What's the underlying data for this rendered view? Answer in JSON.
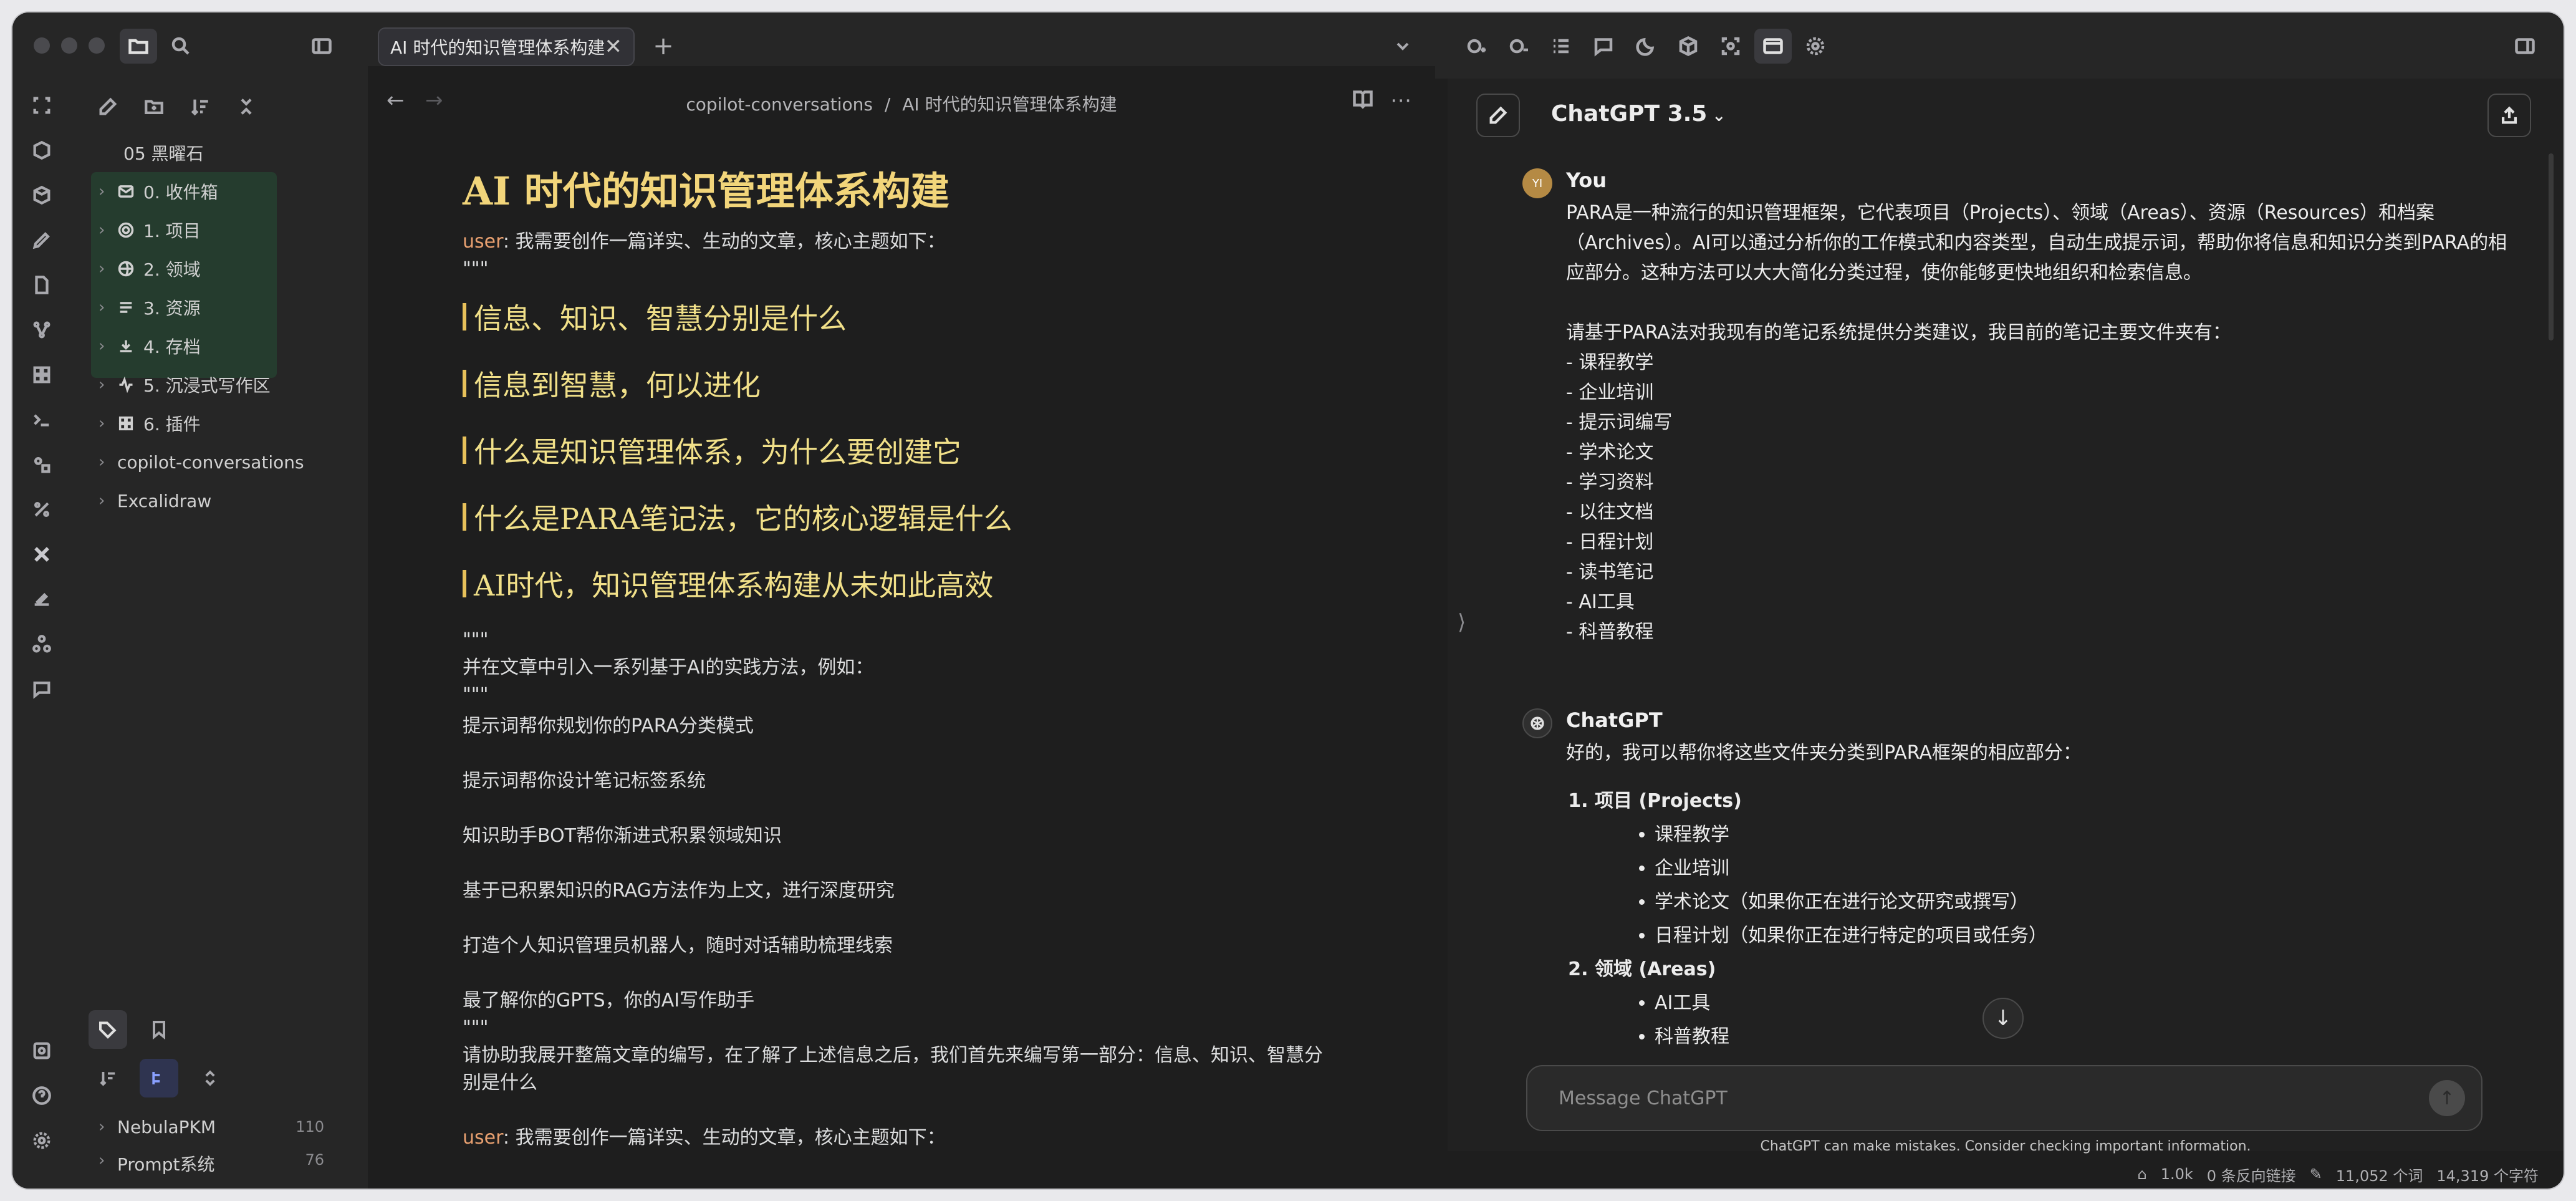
{
  "tab": {
    "title": "AI 时代的知识管理体系构建",
    "close": "✕",
    "add": "+"
  },
  "explorer": {
    "vault_title": "05 黑曜石",
    "items": [
      {
        "label": "0. 收件箱",
        "icon": "inbox-icon"
      },
      {
        "label": "1. 项目",
        "icon": "target-icon"
      },
      {
        "label": "2. 领域",
        "icon": "globe-icon"
      },
      {
        "label": "3. 资源",
        "icon": "list-icon"
      },
      {
        "label": "4. 存档",
        "icon": "download-icon"
      },
      {
        "label": "5. 沉浸式写作区",
        "icon": "activity-icon"
      },
      {
        "label": "6. 插件",
        "icon": "grid-icon"
      },
      {
        "label": "copilot-conversations",
        "icon": ""
      },
      {
        "label": "Excalidraw",
        "icon": ""
      }
    ],
    "tags": [
      {
        "label": "NebulaPKM",
        "count": "110"
      },
      {
        "label": "Prompt系统",
        "count": "76"
      }
    ]
  },
  "editor": {
    "breadcrumb_folder": "copilot-conversations",
    "breadcrumb_sep": "/",
    "breadcrumb_file": "AI 时代的知识管理体系构建",
    "title": "AI 时代的知识管理体系构建",
    "user_label": "user",
    "intro": ": 我需要创作一篇详实、生动的文章，核心主题如下：",
    "quote": "\"\"\"",
    "headings": [
      "信息、知识、智慧分别是什么",
      "信息到智慧，何以进化",
      "什么是知识管理体系，为什么要创建它",
      "什么是PARA笔记法，它的核心逻辑是什么",
      "AI时代，知识管理体系构建从未如此高效"
    ],
    "mid_text": "并在文章中引入一系列基于AI的实践方法，例如：",
    "methods": [
      "提示词帮你规划你的PARA分类模式",
      "提示词帮你设计笔记标签系统",
      "知识助手BOT帮你渐进式积累领域知识",
      "基于已积累知识的RAG方法作为上文，进行深度研究",
      "打造个人知识管理员机器人，随时对话辅助梳理线索",
      "最了解你的GPTS，你的AI写作助手"
    ],
    "request": "请协助我展开整篇文章的编写，在了解了上述信息之后，我们首先来编写第一部分：信息、知识、智慧分别是什么",
    "intro2": ": 我需要创作一篇详实、生动的文章，核心主题如下："
  },
  "chat": {
    "model": "ChatGPT 3.5",
    "user_name": "You",
    "user_avatar": "YI",
    "user_msg_p1": "PARA是一种流行的知识管理框架，它代表项目（Projects）、领域（Areas）、资源（Resources）和档案（Archives）。AI可以通过分析你的工作模式和内容类型，自动生成提示词，帮助你将信息和知识分类到PARA的相应部分。这种方法可以大大简化分类过程，使你能够更快地组织和检索信息。",
    "user_msg_p2": "请基于PARA法对我现有的笔记系统提供分类建议，我目前的笔记主要文件夹有：",
    "folders": [
      "- 课程教学",
      "- 企业培训",
      "- 提示词编写",
      "- 学术论文",
      "- 学习资料",
      "- 以往文档",
      "- 日程计划",
      "- 读书笔记",
      "- AI工具",
      "- 科普教程"
    ],
    "bot_name": "ChatGPT",
    "bot_intro": "好的，我可以帮你将这些文件夹分类到PARA框架的相应部分：",
    "sections": [
      {
        "title": "项目 (Projects)",
        "items": [
          "课程教学",
          "企业培训",
          "学术论文（如果你正在进行论文研究或撰写）",
          "日程计划（如果你正在进行特定的项目或任务）"
        ]
      },
      {
        "title": "领域 (Areas)",
        "items": [
          "AI工具",
          "科普教程"
        ]
      }
    ],
    "placeholder": "Message ChatGPT",
    "disclaimer": "ChatGPT can make mistakes. Consider checking important information."
  },
  "status": {
    "words_small": "1.0k",
    "backlinks": "0 条反向链接",
    "words": "11,052 个词",
    "chars": "14,319 个字符"
  }
}
